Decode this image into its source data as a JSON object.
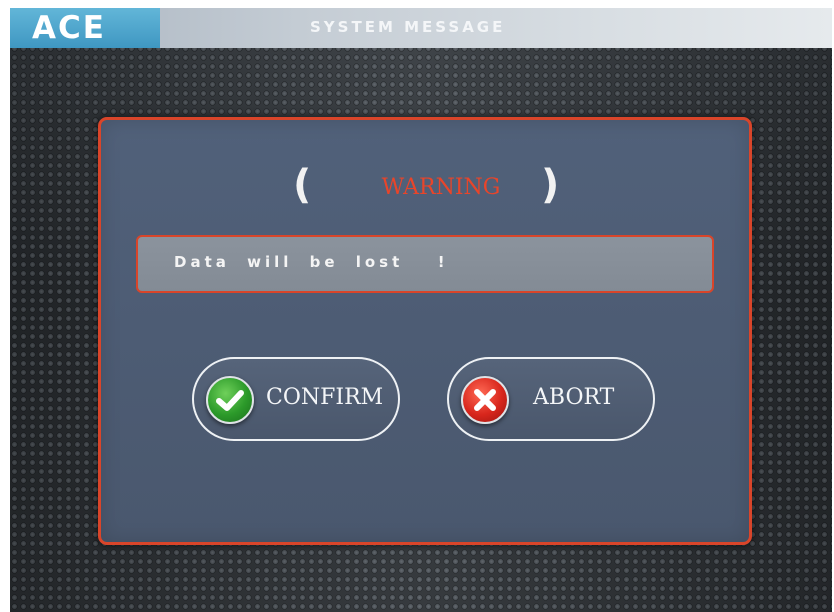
{
  "header": {
    "logo": "ACE",
    "title": "SYSTEM MESSAGE"
  },
  "dialog": {
    "paren_left": "(",
    "title": "WARNING",
    "paren_right": ")",
    "message": "Data will be lost  !"
  },
  "buttons": {
    "confirm": {
      "label": "CONFIRM",
      "icon": "check-icon"
    },
    "abort": {
      "label": "ABORT",
      "icon": "close-icon"
    }
  },
  "colors": {
    "accent_border": "#d9452a",
    "warning_text": "#e8452a",
    "dialog_bg": "#4f5e76",
    "logo_bg": "#4ba6cc",
    "confirm_icon": "#2c9a2a",
    "abort_icon": "#d8261c"
  }
}
